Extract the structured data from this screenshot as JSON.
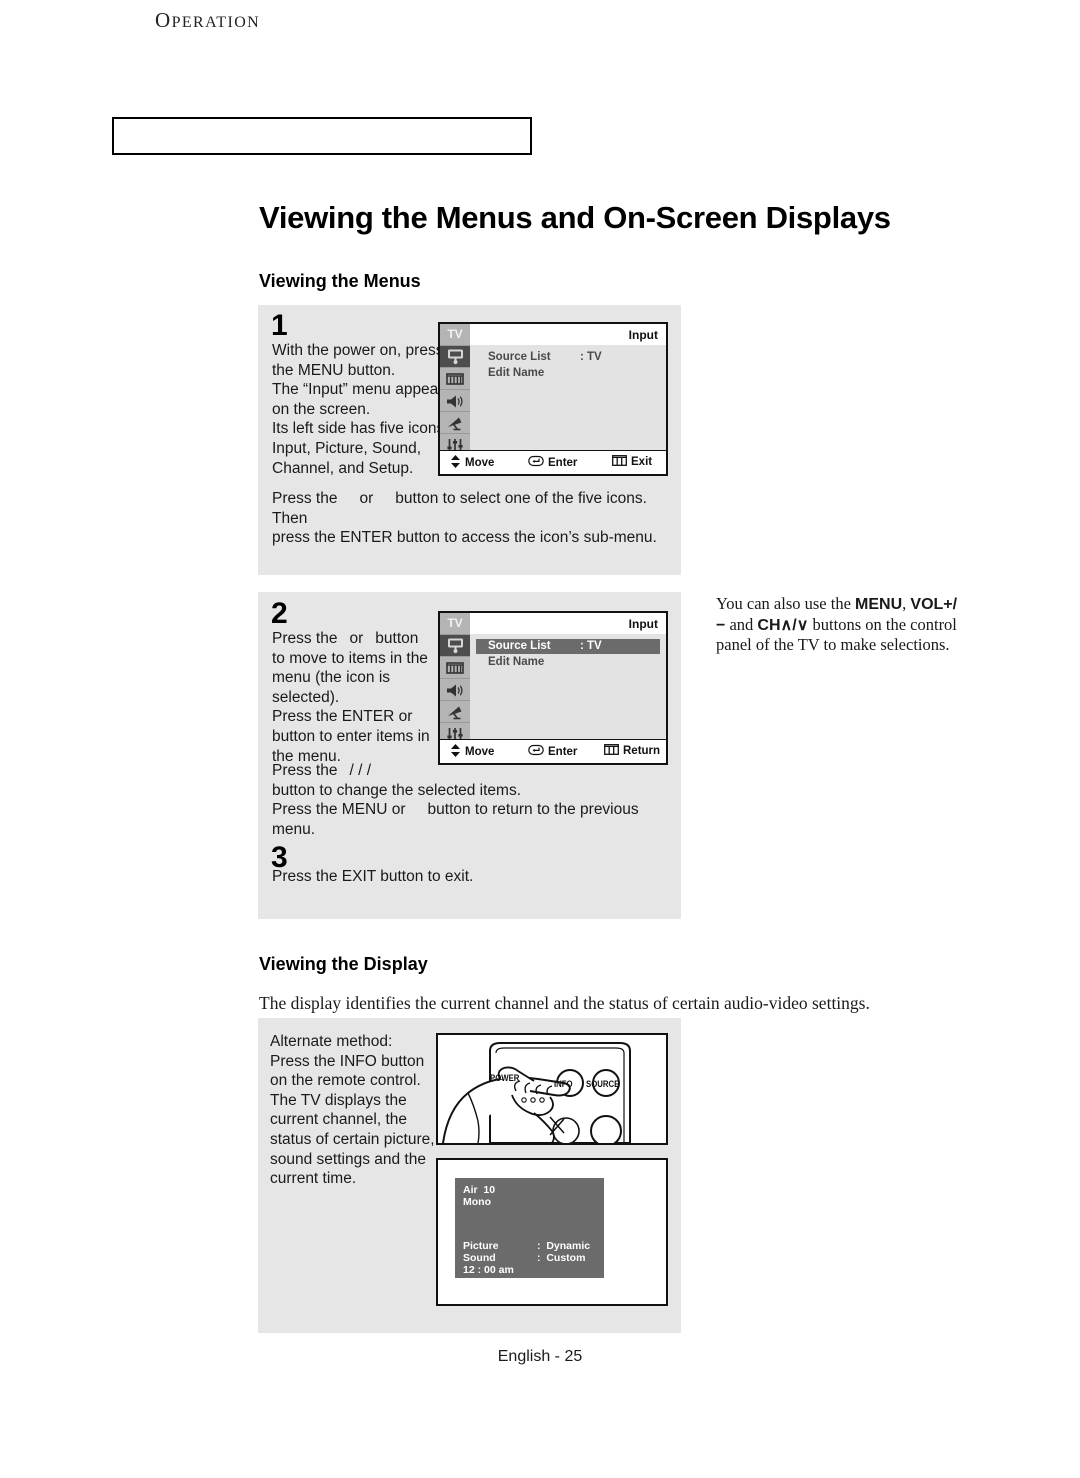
{
  "header": {
    "chapter_initial": "O",
    "chapter_rest": "PERATION"
  },
  "page_title": "Viewing the Menus and On-Screen Displays",
  "sections": {
    "menus_title": "Viewing the Menus",
    "display_title": "Viewing the Display",
    "display_lead": "The display identifies the current channel and the status of certain audio-video settings."
  },
  "steps": {
    "one": {
      "number": "1",
      "text": "With the power on, press the MENU button.\nThe “Input” menu appears on the screen.\nIts left side has five icons: Input, Picture, Sound, Channel, and Setup.",
      "after_line1": "button to select one of the five icons. Then",
      "after_line2": "press the ENTER button to access the icon’s sub-menu.",
      "press_the": "Press the",
      "or": "or"
    },
    "two": {
      "number": "2",
      "text": "button\nto move to items in the menu (the icon is selected).\nPress the ENTER or button to enter items in the menu.",
      "press_the": "Press the",
      "or": "or",
      "press_the_slashes": "Press the",
      "slashes": "/    /    /",
      "after_line2": "button to change the selected items.",
      "after_line3a": "Press the MENU or",
      "after_line3b": "button to return to the previous menu."
    },
    "three": {
      "number": "3",
      "text": "Press the EXIT button to exit."
    }
  },
  "side_note": {
    "line1_pre": "You can also use the ",
    "menu": "MENU",
    "line1_post": ",",
    "vol": "VOL+/−",
    "and": " and ",
    "ch": "CH∧/∨",
    "line2_post": " buttons on",
    "line3": "the control panel of the TV to",
    "line4": "make selections."
  },
  "alternate": {
    "text": "Alternate method:\nPress the INFO button on the remote control.\nThe TV displays the current channel, the status of certain picture, sound settings and the current time."
  },
  "tv_menu_1": {
    "sidebar_label": "TV",
    "title": "Input",
    "rows": [
      {
        "label": "Source List",
        "value": ": TV",
        "highlighted": false
      },
      {
        "label": "Edit Name",
        "value": "",
        "highlighted": false
      }
    ],
    "footer": [
      {
        "icon": "updown-arrow-icon",
        "label": "Move"
      },
      {
        "icon": "enter-key-icon",
        "label": "Enter"
      },
      {
        "icon": "menu-bars-icon",
        "label": "Exit"
      }
    ],
    "icons": [
      "input-monitor-icon",
      "picture-screen-icon",
      "sound-speaker-icon",
      "channel-dish-icon",
      "setup-sliders-icon"
    ]
  },
  "tv_menu_2": {
    "sidebar_label": "TV",
    "title": "Input",
    "rows": [
      {
        "label": "Source List",
        "value": ": TV",
        "highlighted": true
      },
      {
        "label": "Edit Name",
        "value": "",
        "highlighted": false
      }
    ],
    "footer": [
      {
        "icon": "updown-arrow-icon",
        "label": "Move"
      },
      {
        "icon": "enter-key-icon",
        "label": "Enter"
      },
      {
        "icon": "menu-bars-icon",
        "label": "Return"
      }
    ]
  },
  "remote": {
    "labels": [
      "POWER",
      "INFO",
      "SOURCE"
    ]
  },
  "osd": {
    "channel": "Air  10",
    "audio": "Mono",
    "picture_label": "Picture",
    "picture_value": ":  Dynamic",
    "sound_label": "Sound",
    "sound_value": ":  Custom",
    "time": "12 : 00 am"
  },
  "footer": "English - 25",
  "colors": {
    "panel_gray": "#e6e6e6",
    "osd_gray": "#6b6b6b",
    "sidebar_gray": "#b4b4b4",
    "selected_dark": "#4d4d4d"
  }
}
